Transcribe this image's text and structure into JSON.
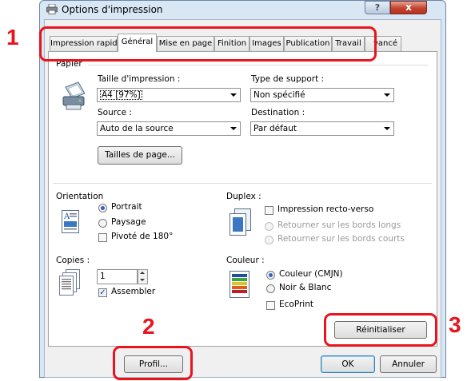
{
  "window": {
    "title": "Options d'impression",
    "help_label": "?",
    "close_label": "x"
  },
  "tabs": [
    "Impression rapide",
    "Général",
    "Mise en page",
    "Finition",
    "Images",
    "Publication",
    "Travail",
    "Avancé"
  ],
  "tabs_visible_text": {
    "avance": "vancé"
  },
  "papier": {
    "section": "Papier",
    "taille_label": "Taille d'impression :",
    "taille_value": "A4  [97%]",
    "type_label": "Type de support :",
    "type_value": "Non spécifié",
    "source_label": "Source :",
    "source_value": "Auto de la source",
    "destination_label": "Destination :",
    "destination_value": "Par défaut",
    "tailles_button": "Tailles de page..."
  },
  "orientation": {
    "label": "Orientation",
    "portrait": "Portrait",
    "paysage": "Paysage",
    "pivote": "Pivoté de 180°",
    "selected": "Portrait"
  },
  "duplex": {
    "label": "Duplex :",
    "recto_verso": "Impression recto-verso",
    "bords_longs": "Retourner sur les bords longs",
    "bords_courts": "Retourner sur les bords courts"
  },
  "copies": {
    "label": "Copies :",
    "value": "1",
    "assembler": "Assembler",
    "assembler_checked": true
  },
  "couleur": {
    "label": "Couleur :",
    "cmjn": "Couleur (CMJN)",
    "noir_blanc": "Noir & Blanc",
    "ecoprint": "EcoPrint",
    "selected": "Couleur (CMJN)"
  },
  "buttons": {
    "reinitialiser": "Réinitialiser",
    "profil": "Profil...",
    "ok": "OK",
    "annuler": "Annuler"
  },
  "callouts": {
    "one": "1",
    "two": "2",
    "three": "3"
  },
  "colors": {
    "highlight": "#e8141e",
    "selection": "#3399ff",
    "panel": "#ffffff",
    "frame": "#d9e6f4"
  }
}
